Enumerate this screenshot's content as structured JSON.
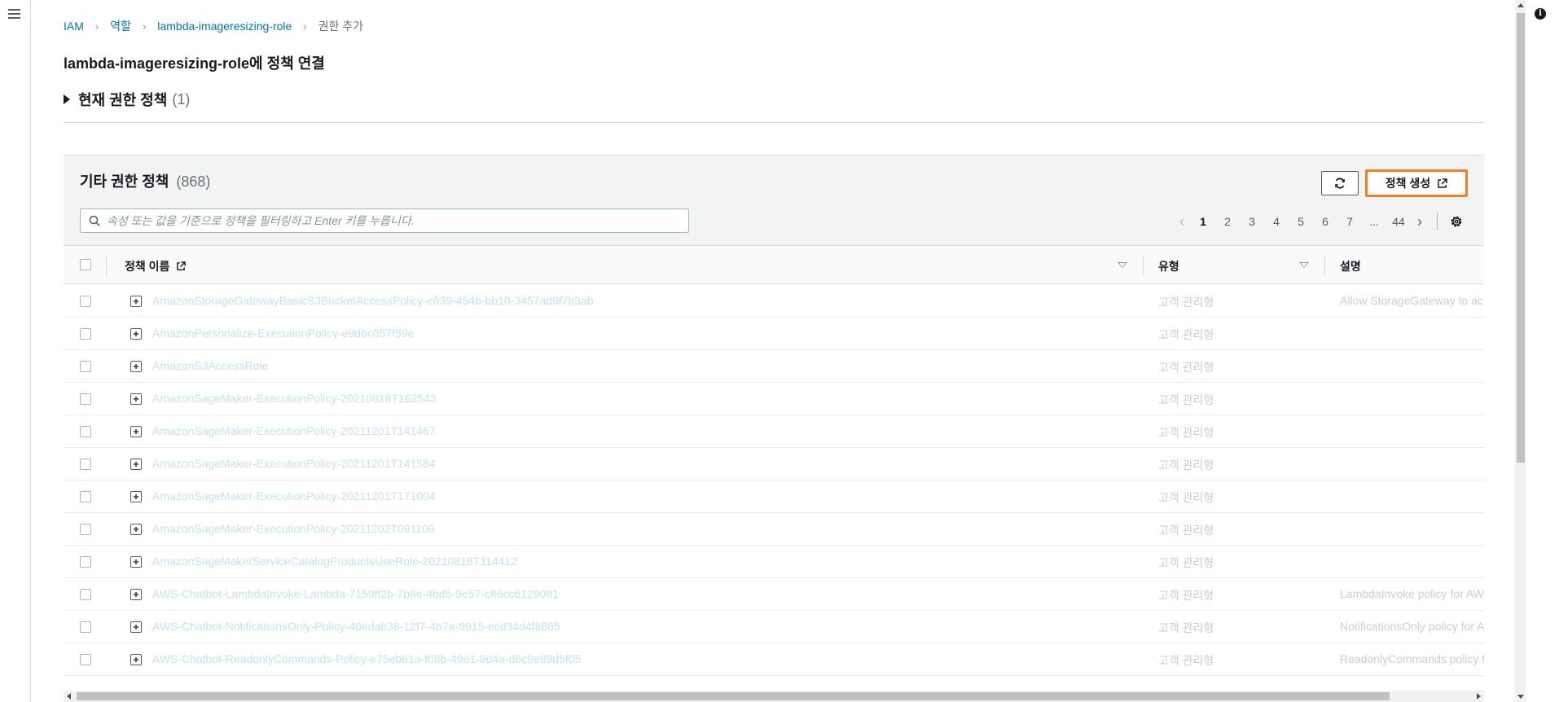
{
  "breadcrumb": {
    "items": [
      "IAM",
      "역할",
      "lambda-imageresizing-role"
    ],
    "current": "권한 추가"
  },
  "page_title": "lambda-imageresizing-role에 정책 연결",
  "current_policies": {
    "label": "현재 권한 정책",
    "count": "(1)"
  },
  "other_policies": {
    "title": "기타 권한 정책",
    "count": "(868)",
    "create_button": "정책 생성",
    "search_placeholder": "속성 또는 값을 기준으로 정책을 필터링하고 Enter 키를 누릅니다.",
    "pagination": {
      "pages": [
        "1",
        "2",
        "3",
        "4",
        "5",
        "6",
        "7",
        "...",
        "44"
      ],
      "current_page": "1"
    }
  },
  "table": {
    "columns": {
      "name": "정책 이름",
      "type": "유형",
      "description": "설명"
    },
    "rows": [
      {
        "name": "AmazonStorageGatewayBasicS3BucketAccessPolicy-e039-454b-bb10-3457ad9f7b3ab",
        "type": "고객 관리형",
        "description": "Allow StorageGateway to ac"
      },
      {
        "name": "AmazonPersonalize-ExecutionPolicy-e9dbc057f59e",
        "type": "고객 관리형",
        "description": ""
      },
      {
        "name": "AmazonS3AccessRole",
        "type": "고객 관리형",
        "description": ""
      },
      {
        "name": "AmazonSageMaker-ExecutionPolicy-20210818T162543",
        "type": "고객 관리형",
        "description": ""
      },
      {
        "name": "AmazonSageMaker-ExecutionPolicy-20211201T141467",
        "type": "고객 관리형",
        "description": ""
      },
      {
        "name": "AmazonSageMaker-ExecutionPolicy-20211201T141584",
        "type": "고객 관리형",
        "description": ""
      },
      {
        "name": "AmazonSageMaker-ExecutionPolicy-20211201T171004",
        "type": "고객 관리형",
        "description": ""
      },
      {
        "name": "AmazonSageMaker-ExecutionPolicy-20211202T091106",
        "type": "고객 관리형",
        "description": ""
      },
      {
        "name": "AmazonSageMakerServiceCatalogProductsUseRole-20210818T114412",
        "type": "고객 관리형",
        "description": ""
      },
      {
        "name": "AWS-Chatbot-LambdaInvoke-Lambda-7159ff2b-7b8e-4bd5-9e57-c86cc6129081",
        "type": "고객 관리형",
        "description": "LambdaInvoke policy for AW"
      },
      {
        "name": "AWS-Chatbot-NotificationsOnly-Policy-40edab38-12f7-4b7a-9915-ecd34d4f8865",
        "type": "고객 관리형",
        "description": "NotificationsOnly policy for A"
      },
      {
        "name": "AWS-Chatbot-ReadonlyCommands-Policy-e75eb61a-f08b-49e1-9d4a-d6c9e89d5f05",
        "type": "고객 관리형",
        "description": "ReadonlyCommands policy f"
      }
    ]
  },
  "colors": {
    "accent": "#f57e23",
    "link": "#0073bb",
    "text": "#16191f",
    "header_bg": "#f2f3f3"
  }
}
